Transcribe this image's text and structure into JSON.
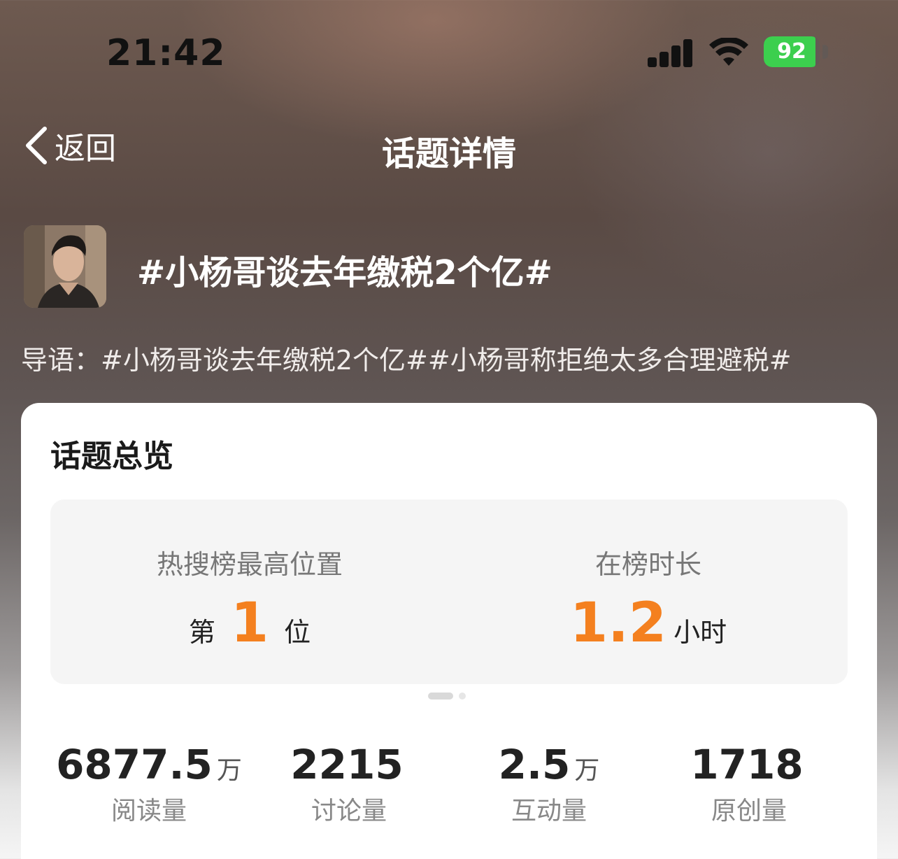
{
  "status_bar": {
    "time": "21:42",
    "battery_text": "92",
    "battery_level": 0.92
  },
  "nav": {
    "back_label": "返回",
    "title": "话题详情"
  },
  "topic": {
    "title": "#小杨哥谈去年缴税2个亿#",
    "intro": "导语：#小杨哥谈去年缴税2个亿##小杨哥称拒绝太多合理避税#"
  },
  "overview": {
    "title": "话题总览",
    "rank": {
      "label": "热搜榜最高位置",
      "prefix": "第",
      "value": "1",
      "suffix": "位"
    },
    "duration": {
      "label": "在榜时长",
      "value": "1.2",
      "suffix": "小时"
    },
    "stats": [
      {
        "value": "6877.5",
        "unit": "万",
        "label": "阅读量"
      },
      {
        "value": "2215",
        "unit": "",
        "label": "讨论量"
      },
      {
        "value": "2.5",
        "unit": "万",
        "label": "互动量"
      },
      {
        "value": "1718",
        "unit": "",
        "label": "原创量"
      }
    ]
  },
  "colors": {
    "accent": "#f4801f",
    "battery": "#3ccf4e"
  }
}
